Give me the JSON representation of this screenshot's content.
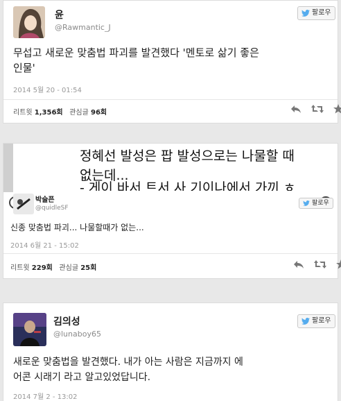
{
  "tweets": [
    {
      "name": "윤",
      "handle": "@Rawmantic_J",
      "follow": "팔로우",
      "text_lines": [
        "무섭고 새로운 맞춤법 파괴를 발견했다 '멘토로 삶기 좋은",
        "인물'"
      ],
      "time": "2014 5월 20 - 01:54",
      "retweet_label": "리트윗",
      "retweet_count": "1,356회",
      "fav_label": "관심글",
      "fav_count": "96회"
    },
    {
      "quoted_lines": [
        "정혜선 발성은 팝 발성으로는 나물할 때",
        "없는데...",
        "- 게이 바서 트서 사 기이나에서 가끼 ㅎ"
      ],
      "name": "박술픈",
      "handle": "@quidleSF",
      "follow": "팔로우",
      "text": "신종 맞춤법 파괴... 나물할때가 없는...",
      "time": "2014 6월 21 - 15:02",
      "retweet_label": "리트윗",
      "retweet_count": "229회",
      "fav_label": "관심글",
      "fav_count": "25회"
    },
    {
      "name": "김의성",
      "handle": "@lunaboy65",
      "follow": "팔로우",
      "text_lines": [
        "새로운 맞춤법을 발견했다. 내가 아는 사람은 지금까지 에",
        "어콘 시래기 라고 알고있었답니다."
      ],
      "time": "2014 7월 2 - 13:02"
    }
  ],
  "colors": {
    "twitter_blue": "#55acee",
    "background": "#e8e8e8"
  },
  "icons": [
    "twitter-bird-icon",
    "reply-icon",
    "retweet-icon",
    "favorite-icon"
  ]
}
